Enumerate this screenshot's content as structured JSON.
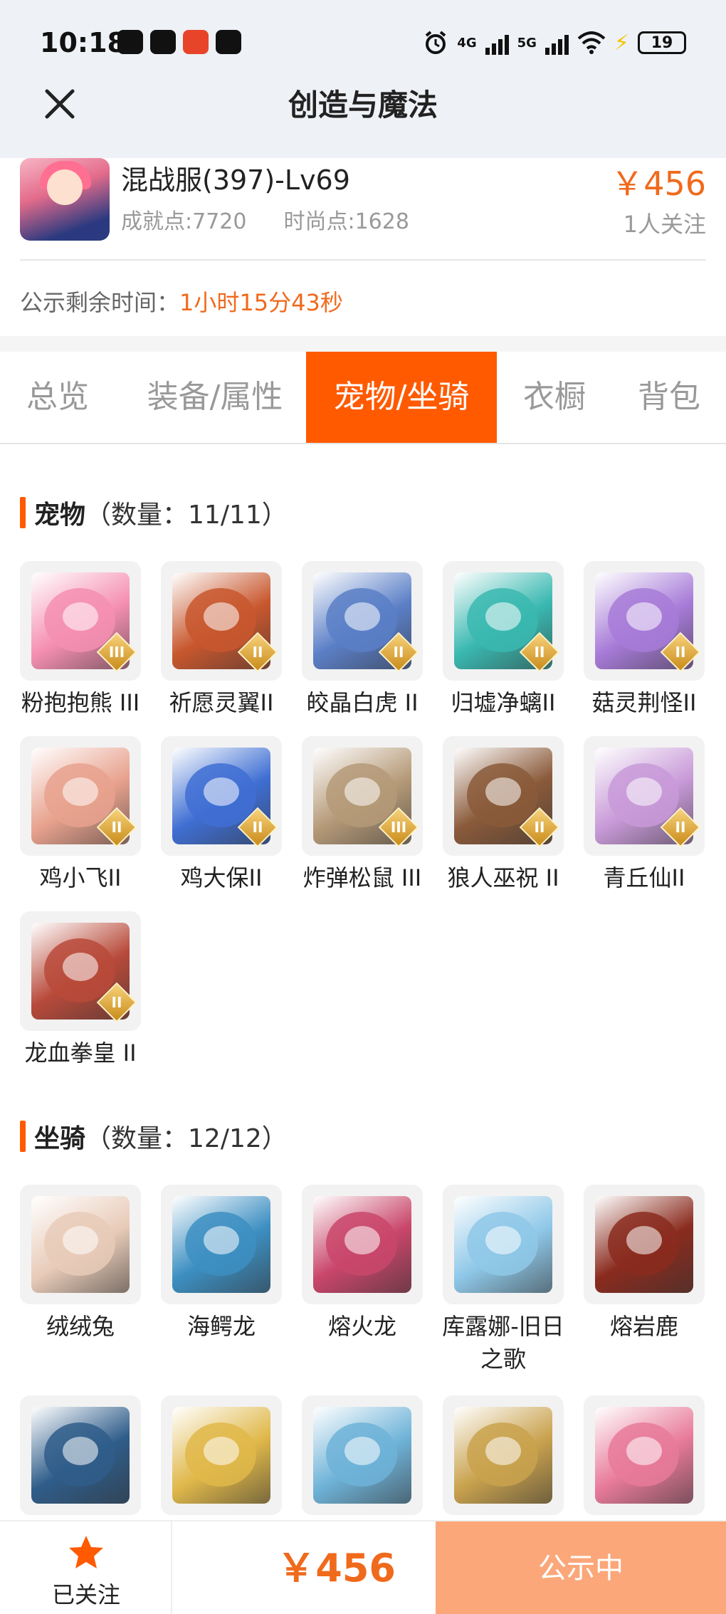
{
  "status_bar": {
    "time": "10:18",
    "signal_1": "4G",
    "signal_2": "5G",
    "battery": "19"
  },
  "header": {
    "title": "创造与魔法",
    "close_icon": "close-icon"
  },
  "character": {
    "name": "混战服(397)-Lv69",
    "achievement": "成就点:7720",
    "fashion": "时尚点:1628",
    "price": "￥456",
    "followers": "1人关注",
    "remaining_label": "公示剩余时间：",
    "remaining_value": "1小时15分43秒"
  },
  "tabs": [
    {
      "label": "总览"
    },
    {
      "label": "装备/属性"
    },
    {
      "label": "宠物/坐骑",
      "active": true
    },
    {
      "label": "衣橱"
    },
    {
      "label": "背包"
    }
  ],
  "pets": {
    "title": "宠物",
    "count": "（数量：11/11）",
    "items": [
      {
        "label": "粉抱抱熊 III",
        "badge": "III",
        "color": "#f58fb2",
        "icon": "pink-bear-icon"
      },
      {
        "label": "祈愿灵翼II",
        "badge": "II",
        "color": "#c8572e",
        "icon": "wing-bird-icon"
      },
      {
        "label": "皎晶白虎 II",
        "badge": "II",
        "color": "#5b7fc7",
        "icon": "white-tiger-icon"
      },
      {
        "label": "归墟净螭II",
        "badge": "II",
        "color": "#39b8b0",
        "icon": "dragon-icon"
      },
      {
        "label": "菇灵荆怪II",
        "badge": "II",
        "color": "#a77bd8",
        "icon": "mushroom-spirit-icon"
      },
      {
        "label": "鸡小飞II",
        "badge": "II",
        "color": "#e8a28e",
        "icon": "chick-icon"
      },
      {
        "label": "鸡大保II",
        "badge": "II",
        "color": "#3f6fd3",
        "icon": "bird-sunglasses-icon"
      },
      {
        "label": "炸弹松鼠 III",
        "badge": "III",
        "color": "#b59a78",
        "icon": "squirrel-icon"
      },
      {
        "label": "狼人巫祝 II",
        "badge": "II",
        "color": "#8a5a3a",
        "icon": "werewolf-icon"
      },
      {
        "label": "青丘仙II",
        "badge": "II",
        "color": "#c89ad8",
        "icon": "fox-fairy-icon"
      },
      {
        "label": "龙血拳皇 II",
        "badge": "II",
        "color": "#b84a3a",
        "icon": "dragon-boxer-icon"
      }
    ]
  },
  "mounts": {
    "title": "坐骑",
    "count": "（数量：12/12）",
    "items": [
      {
        "label": "绒绒兔",
        "color": "#e8cbb8",
        "icon": "rabbit-icon"
      },
      {
        "label": "海鳄龙",
        "color": "#3d8fc2",
        "icon": "sea-dragon-icon"
      },
      {
        "label": "熔火龙",
        "color": "#c9466a",
        "icon": "fire-dragon-icon"
      },
      {
        "label": "库露娜-旧日之歌",
        "color": "#8fc8e8",
        "icon": "kuluna-icon"
      },
      {
        "label": "熔岩鹿",
        "color": "#8a2b1e",
        "icon": "lava-deer-icon"
      },
      {
        "label": "",
        "color": "#2f5d8a",
        "icon": "dark-dragon-icon"
      },
      {
        "label": "",
        "color": "#e0b84a",
        "icon": "golden-throne-icon"
      },
      {
        "label": "",
        "color": "#6fb3d8",
        "icon": "ice-dragon-icon"
      },
      {
        "label": "",
        "color": "#c9a24e",
        "icon": "owl-icon"
      },
      {
        "label": "",
        "color": "#e87a9a",
        "icon": "headphone-bird-icon"
      }
    ]
  },
  "bottom_bar": {
    "follow_label": "已关注",
    "price": "￥456",
    "action_label": "公示中"
  }
}
